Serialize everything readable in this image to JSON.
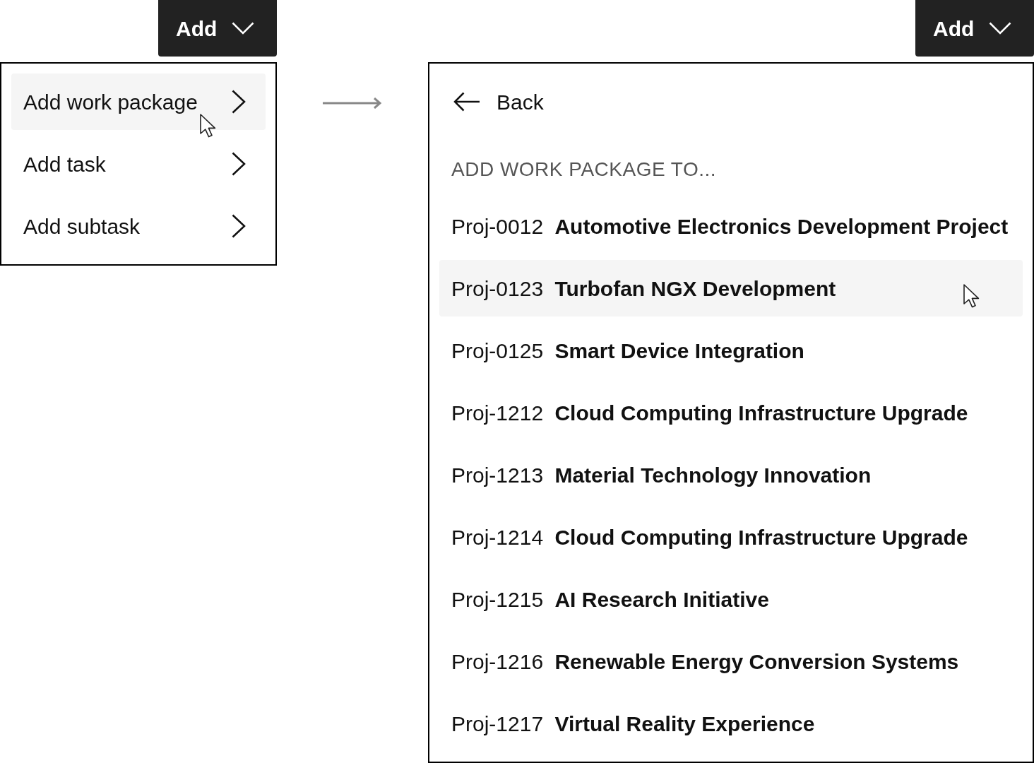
{
  "left_panel": {
    "add_button": {
      "label": "Add"
    },
    "menu": {
      "items": [
        {
          "label": "Add work package",
          "selected": true
        },
        {
          "label": "Add task",
          "selected": false
        },
        {
          "label": "Add subtask",
          "selected": false
        }
      ]
    }
  },
  "right_panel": {
    "add_button": {
      "label": "Add"
    },
    "back_button": {
      "label": "Back"
    },
    "heading": "ADD WORK PACKAGE TO...",
    "projects": [
      {
        "code": "Proj-0012",
        "name": "Automotive Electronics Development Project",
        "selected": false
      },
      {
        "code": "Proj-0123",
        "name": "Turbofan NGX Development",
        "selected": true
      },
      {
        "code": "Proj-0125",
        "name": "Smart Device Integration",
        "selected": false
      },
      {
        "code": "Proj-1212",
        "name": "Cloud Computing Infrastructure Upgrade",
        "selected": false
      },
      {
        "code": "Proj-1213",
        "name": "Material Technology Innovation",
        "selected": false
      },
      {
        "code": "Proj-1214",
        "name": "Cloud Computing Infrastructure Upgrade",
        "selected": false
      },
      {
        "code": "Proj-1215",
        "name": "AI Research Initiative",
        "selected": false
      },
      {
        "code": "Proj-1216",
        "name": "Renewable Energy Conversion Systems",
        "selected": false
      },
      {
        "code": "Proj-1217",
        "name": "Virtual Reality Experience",
        "selected": false
      }
    ]
  }
}
